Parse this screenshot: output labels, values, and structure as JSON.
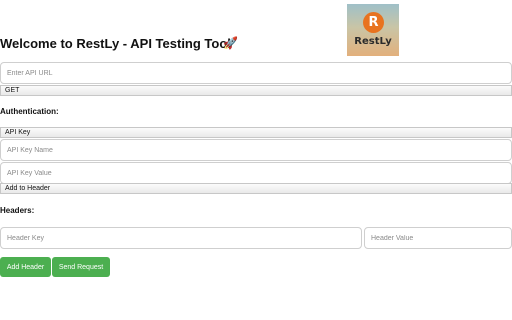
{
  "logo": {
    "letter": "R",
    "text": "RestLy"
  },
  "header": {
    "title": "Welcome to RestLy - API Testing Tool",
    "rocket": "🚀"
  },
  "request": {
    "url_placeholder": "Enter API URL",
    "method": "GET"
  },
  "auth": {
    "label": "Authentication:",
    "type": "API Key",
    "key_name_placeholder": "API Key Name",
    "key_value_placeholder": "API Key Value",
    "location": "Add to Header"
  },
  "headers": {
    "label": "Headers:",
    "key_placeholder": "Header Key",
    "value_placeholder": "Header Value"
  },
  "buttons": {
    "add_header": "Add Header",
    "send_request": "Send Request"
  },
  "colors": {
    "button": "#4caf50",
    "logo_accent": "#e8731f"
  }
}
